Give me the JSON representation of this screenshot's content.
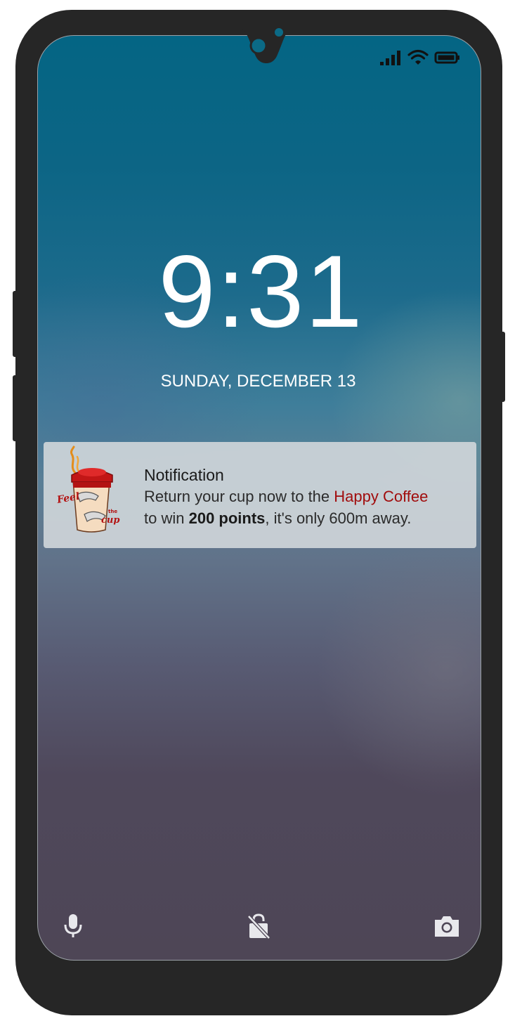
{
  "status_bar": {
    "icons": [
      "signal-icon",
      "wifi-icon",
      "battery-icon"
    ]
  },
  "lock_screen": {
    "time": "9:31",
    "date": "SUNDAY, DECEMBER 13"
  },
  "notification": {
    "app_logo": "feel-the-cup-logo",
    "title": "Notification",
    "line1_prefix": "Return your cup now to the ",
    "line1_brand": "Happy Coffee",
    "line2_prefix": "to win ",
    "line2_points": "200 points",
    "line2_suffix": ", it's only 600m away.",
    "brand_color": "#a10d0d"
  },
  "bottom_bar": {
    "icons": [
      "microphone-icon",
      "unlock-icon",
      "camera-icon"
    ]
  },
  "colors": {
    "phone_frame": "#262626",
    "wallpaper_top": "#046584",
    "wallpaper_bottom": "#4e4656",
    "notification_bg": "#cdd4d8"
  }
}
